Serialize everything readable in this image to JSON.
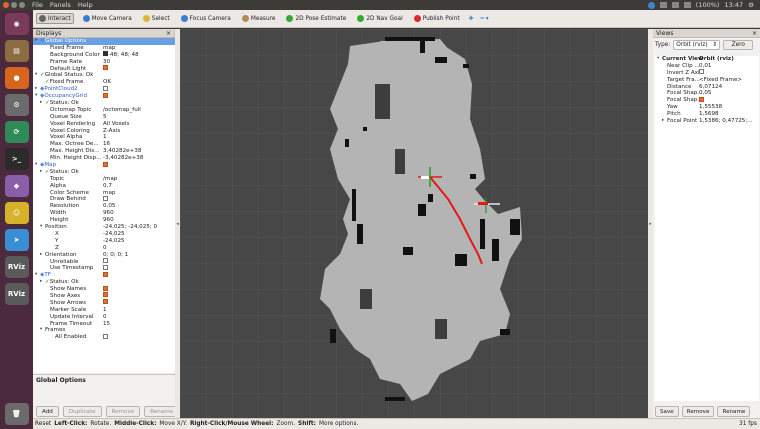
{
  "menubar": {
    "items": [
      "File",
      "Panels",
      "Help"
    ],
    "clock": "13:47",
    "battery": "(100%)"
  },
  "toolbar": {
    "tools": [
      {
        "label": "Interact",
        "icon": "cursor-icon",
        "active": true,
        "color": "#666"
      },
      {
        "label": "Move Camera",
        "icon": "move-camera-icon",
        "color": "#3a7bd5"
      },
      {
        "label": "Select",
        "icon": "select-icon",
        "color": "#e0b43a"
      },
      {
        "label": "Focus Camera",
        "icon": "focus-camera-icon",
        "color": "#3a7bd5"
      },
      {
        "label": "Measure",
        "icon": "ruler-icon",
        "color": "#b38b5a"
      },
      {
        "label": "2D Pose Estimate",
        "icon": "pose-estimate-icon",
        "color": "#34a834"
      },
      {
        "label": "2D Nav Goal",
        "icon": "nav-goal-icon",
        "color": "#34a834"
      },
      {
        "label": "Publish Point",
        "icon": "publish-point-icon",
        "color": "#d62b2b"
      }
    ]
  },
  "displays": {
    "title": "Displays",
    "close": "×",
    "buttons": {
      "add": "Add",
      "duplicate": "Duplicate",
      "remove": "Remove",
      "rename": "Rename"
    },
    "description_title": "Global Options",
    "rows": [
      {
        "d": 0,
        "arrow": "▾",
        "icon": "gear",
        "key": "Global Options",
        "sel": true
      },
      {
        "d": 2,
        "key": "Fixed Frame",
        "val": "map"
      },
      {
        "d": 2,
        "key": "Background Color",
        "val": "48; 48; 48",
        "swatch": true
      },
      {
        "d": 2,
        "key": "Frame Rate",
        "val": "30"
      },
      {
        "d": 2,
        "key": "Default Light",
        "check": true
      },
      {
        "d": 0,
        "arrow": "▾",
        "ok": true,
        "key": "Global Status: Ok"
      },
      {
        "d": 1,
        "ok": true,
        "key": "Fixed Frame",
        "val": "OK"
      },
      {
        "d": 0,
        "arrow": "▸",
        "icon": "cloud",
        "key": "PointCloud2",
        "blue": true,
        "check": false
      },
      {
        "d": 0,
        "arrow": "▾",
        "icon": "grid",
        "key": "OccupancyGrid",
        "blue": true,
        "check": true
      },
      {
        "d": 1,
        "arrow": "▸",
        "ok": true,
        "key": "Status: Ok"
      },
      {
        "d": 2,
        "key": "Octomap Topic",
        "val": "/octomap_full"
      },
      {
        "d": 2,
        "key": "Queue Size",
        "val": "5"
      },
      {
        "d": 2,
        "key": "Voxel Rendering",
        "val": "All Voxels"
      },
      {
        "d": 2,
        "key": "Voxel Coloring",
        "val": "Z-Axis"
      },
      {
        "d": 2,
        "key": "Voxel Alpha",
        "val": "1"
      },
      {
        "d": 2,
        "key": "Max. Octree De...",
        "val": "16"
      },
      {
        "d": 2,
        "key": "Max. Height Dis...",
        "val": "3,40282e+38"
      },
      {
        "d": 2,
        "key": "Min. Height Disp...",
        "val": "-3,40282e+38"
      },
      {
        "d": 0,
        "arrow": "▾",
        "icon": "map",
        "key": "Map",
        "blue": true,
        "check": true
      },
      {
        "d": 1,
        "arrow": "▸",
        "ok": true,
        "key": "Status: Ok"
      },
      {
        "d": 2,
        "key": "Topic",
        "val": "/map"
      },
      {
        "d": 2,
        "key": "Alpha",
        "val": "0,7"
      },
      {
        "d": 2,
        "key": "Color Scheme",
        "val": "map"
      },
      {
        "d": 2,
        "key": "Draw Behind",
        "check": false
      },
      {
        "d": 2,
        "key": "Resolution",
        "val": "0,05"
      },
      {
        "d": 2,
        "key": "Width",
        "val": "960"
      },
      {
        "d": 2,
        "key": "Height",
        "val": "960"
      },
      {
        "d": 1,
        "arrow": "▾",
        "key": "Position",
        "val": "-24,025; -24,025; 0"
      },
      {
        "d": 3,
        "key": "X",
        "val": "-24,025"
      },
      {
        "d": 3,
        "key": "Y",
        "val": "-24,025"
      },
      {
        "d": 3,
        "key": "Z",
        "val": "0"
      },
      {
        "d": 1,
        "arrow": "▸",
        "key": "Orientation",
        "val": "0; 0; 0; 1"
      },
      {
        "d": 2,
        "key": "Unreliable",
        "check": false
      },
      {
        "d": 2,
        "key": "Use Timestamp",
        "check": false
      },
      {
        "d": 0,
        "arrow": "▾",
        "icon": "tf",
        "key": "TF",
        "blue": true,
        "check": true
      },
      {
        "d": 1,
        "arrow": "▸",
        "ok": true,
        "key": "Status: Ok"
      },
      {
        "d": 2,
        "key": "Show Names",
        "check": true
      },
      {
        "d": 2,
        "key": "Show Axes",
        "check": true
      },
      {
        "d": 2,
        "key": "Show Arrows",
        "check": true
      },
      {
        "d": 2,
        "key": "Marker Scale",
        "val": "1"
      },
      {
        "d": 2,
        "key": "Update Interval",
        "val": "0"
      },
      {
        "d": 2,
        "key": "Frame Timeout",
        "val": "15"
      },
      {
        "d": 1,
        "arrow": "▾",
        "key": "Frames"
      },
      {
        "d": 3,
        "key": "All Enabled",
        "check": false
      }
    ]
  },
  "views": {
    "title": "Views",
    "type_label": "Type:",
    "type_value": "Orbit (rviz)",
    "zero": "Zero",
    "rows": [
      {
        "d": 0,
        "arrow": "▾",
        "key": "Current View",
        "val": "Orbit (rviz)",
        "bold": true
      },
      {
        "d": 1,
        "key": "Near Clip ...",
        "val": "0,01"
      },
      {
        "d": 1,
        "key": "Invert Z Axis",
        "check": false
      },
      {
        "d": 1,
        "key": "Target Fra...",
        "val": "<Fixed Frame>"
      },
      {
        "d": 1,
        "key": "Distance",
        "val": "6,07124"
      },
      {
        "d": 1,
        "key": "Focal Shap...",
        "val": "0,05"
      },
      {
        "d": 1,
        "key": "Focal Shap...",
        "check": true
      },
      {
        "d": 1,
        "key": "Yaw",
        "val": "1,55538"
      },
      {
        "d": 1,
        "key": "Pitch",
        "val": "1,5698"
      },
      {
        "d": 1,
        "arrow": "▸",
        "key": "Focal Point",
        "val": "1,5386; 0,47725;..."
      }
    ],
    "buttons": {
      "save": "Save",
      "remove": "Remove",
      "rename": "Rename"
    }
  },
  "statusbar": {
    "reset": "Reset",
    "left_click": "Left-Click:",
    "left_action": "Rotate.",
    "middle_click": "Middle-Click:",
    "middle_action": "Move X/Y.",
    "right_click": "Right-Click/Mouse Wheel:",
    "right_action": "Zoom.",
    "shift": "Shift:",
    "shift_action": "More options.",
    "fps": "31 fps"
  },
  "launcher": [
    {
      "name": "dash-icon",
      "color": "#7a3a5a",
      "glyph": "◉"
    },
    {
      "name": "files-icon",
      "color": "#8b6c43",
      "glyph": "▤"
    },
    {
      "name": "firefox-icon",
      "color": "#d9641e",
      "glyph": "●"
    },
    {
      "name": "settings-icon",
      "color": "#6b6b6b",
      "glyph": "⚙"
    },
    {
      "name": "software-icon",
      "color": "#2e8b57",
      "glyph": "⟳"
    },
    {
      "name": "terminal-icon",
      "color": "#2b2b2b",
      "glyph": ">_"
    },
    {
      "name": "rviz-icon",
      "color": "#8a5ea8",
      "glyph": "◆"
    },
    {
      "name": "face-icon",
      "color": "#d6b22b",
      "glyph": "☺"
    },
    {
      "name": "telegram-icon",
      "color": "#3a8fd4",
      "glyph": "➤"
    },
    {
      "name": "rviz-app-icon",
      "color": "#5a5a5a",
      "glyph": "RViz"
    },
    {
      "name": "rviz-app2-icon",
      "color": "#5a5a5a",
      "glyph": "RViz"
    },
    {
      "name": "trash-icon",
      "color": "#6b6b6b",
      "glyph": "🗑"
    }
  ]
}
